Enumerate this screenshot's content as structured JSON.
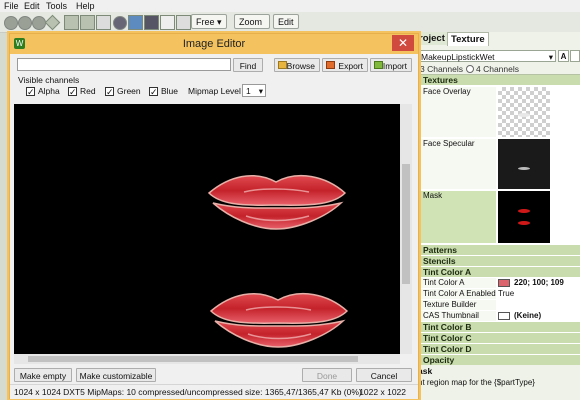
{
  "menu": [
    "File",
    "Edit",
    "Tools",
    "Help"
  ],
  "toolbar": {
    "free_label": "Free",
    "zoom_label": "Zoom",
    "edit_label": "Edit"
  },
  "right_panel": {
    "tab_project": "roject",
    "tab_texture": "Texture",
    "dropdown_value": "MakeupLipstickWet",
    "channels_a": "3 Channels",
    "channels_b": "4 Channels",
    "categories": {
      "textures": "Textures",
      "patterns": "Patterns",
      "stencils": "Stencils",
      "tint_a": "Tint Color A",
      "tint_b": "Tint Color B",
      "tint_c": "Tint Color C",
      "tint_d": "Tint Color D",
      "opacity": "Opacity"
    },
    "texture_rows": [
      "Face Overlay",
      "Face Specular",
      "Mask"
    ],
    "props": [
      {
        "label": "Tint Color A",
        "value": "220; 100; 109",
        "swatch": "#dc646d"
      },
      {
        "label": "Tint Color A Enabled",
        "value": "True"
      },
      {
        "label": "Texture Builder",
        "value": ""
      },
      {
        "label": "CAS Thumbnail",
        "value": "(Keine)",
        "swatch": "#ffffff"
      }
    ],
    "help_title": "ask",
    "help_text": "nt region map for the {$partType}"
  },
  "dialog": {
    "title": "Image Editor",
    "close": "✕",
    "find_placeholder": "",
    "find_label": "Find",
    "browse_label": "Browse",
    "export_label": "Export",
    "import_label": "Import",
    "visible_channels": "Visible channels",
    "channels": [
      "Alpha",
      "Red",
      "Green",
      "Blue"
    ],
    "mipmap_label": "Mipmap Level",
    "mipmap_value": "1",
    "make_empty": "Make empty",
    "make_customizable": "Make customizable",
    "done": "Done",
    "cancel": "Cancel",
    "status_left": "1024 x 1024 DXT5 MipMaps: 10 compressed/uncompressed size: 1365,47/1365,47 Kb (0%)",
    "status_right": "1022 x 1022"
  },
  "colors": {
    "accent_title": "#f4c35f",
    "close_red": "#d04a3e",
    "category_green": "#c9dcae",
    "lip_red": "#c8232b"
  }
}
